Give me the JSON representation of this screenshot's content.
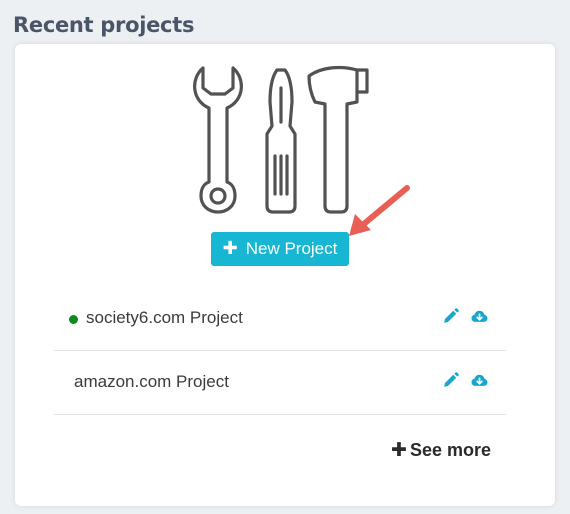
{
  "section": {
    "title": "Recent projects"
  },
  "new_project_button": {
    "icon": "plus-icon",
    "label": "New Project"
  },
  "projects": [
    {
      "name": "society6.com Project",
      "status": "active",
      "status_color": "#0c8a1f",
      "actions": [
        "pencil-icon",
        "cloud-download-icon"
      ]
    },
    {
      "name": "amazon.com Project",
      "actions": [
        "pencil-icon",
        "cloud-download-icon"
      ]
    }
  ],
  "see_more": {
    "icon": "plus-icon",
    "label": "See more"
  },
  "colors": {
    "accent": "#17b6d3",
    "heading": "#4b5468",
    "annotation_arrow": "#e85f55",
    "status_active": "#0c8a1f",
    "page_background": "#edf0f3"
  }
}
